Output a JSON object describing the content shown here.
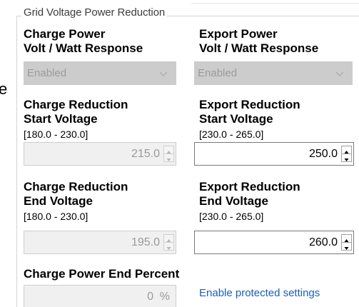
{
  "stray_text": "e",
  "group": {
    "title": "Grid Voltage Power Reduction"
  },
  "charge_vw": {
    "label_line1": "Charge Power",
    "label_line2": "Volt / Watt Response",
    "value": "Enabled"
  },
  "export_vw": {
    "label_line1": "Export Power",
    "label_line2": "Volt / Watt Response",
    "value": "Enabled"
  },
  "charge_start": {
    "label_line1": "Charge Reduction",
    "label_line2": "Start Voltage",
    "range": "[180.0 - 230.0]",
    "value": "215.0"
  },
  "export_start": {
    "label_line1": "Export Reduction",
    "label_line2": "Start Voltage",
    "range": "[230.0 - 265.0]",
    "value": "250.0"
  },
  "charge_end": {
    "label_line1": "Charge Reduction",
    "label_line2": "End Voltage",
    "range": "[180.0 - 230.0]",
    "value": "195.0"
  },
  "export_end": {
    "label_line1": "Export Reduction",
    "label_line2": "End Voltage",
    "range": "[230.0 - 265.0]",
    "value": "260.0"
  },
  "charge_end_percent": {
    "label": "Charge Power End Percent",
    "value": "0",
    "unit": "%"
  },
  "link": {
    "label": "Enable protected settings"
  },
  "icons": {
    "dropdown": "chevron-down-icon",
    "spin_up": "arrow-up-icon",
    "spin_down": "arrow-down-icon"
  },
  "colors": {
    "disabled_bg": "#cccccc",
    "disabled_text": "#9b9b9b",
    "link": "#1a5fb4"
  }
}
